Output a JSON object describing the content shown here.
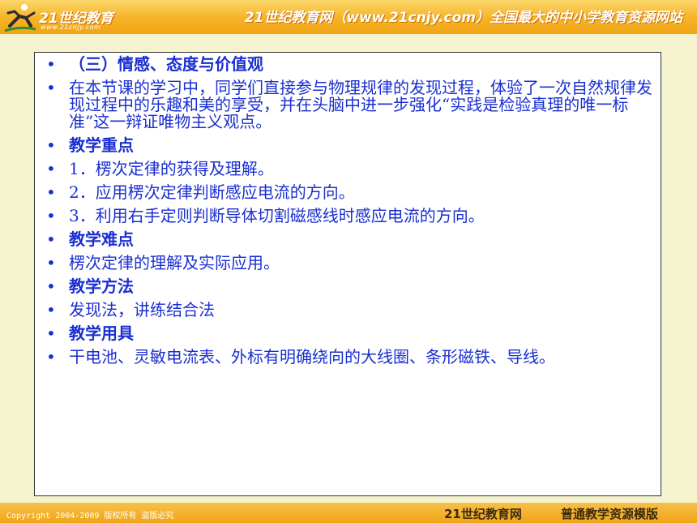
{
  "header": {
    "logo_text": "21世纪教育",
    "logo_url": "www.21cnjy.com",
    "tagline": "21世纪教育网（www.21cnjy.com）全国最大的中小学教育资源网站"
  },
  "content": {
    "items": [
      {
        "text": "（三）情感、态度与价值观",
        "bold": true
      },
      {
        "text": "在本节课的学习中，同学们直接参与物理规律的发现过程，体验了一次自然规律发现过程中的乐趣和美的享受，并在头脑中进一步强化“实践是检验真理的唯一标准”这一辩证唯物主义观点。",
        "bold": false
      },
      {
        "text": "教学重点",
        "bold": true
      },
      {
        "text": "1．楞次定律的获得及理解。",
        "bold": false
      },
      {
        "text": "2．应用楞次定律判断感应电流的方向。",
        "bold": false
      },
      {
        "text": "3．利用右手定则判断导体切割磁感线时感应电流的方向。",
        "bold": false
      },
      {
        "text": "教学难点",
        "bold": true
      },
      {
        "text": "楞次定律的理解及实际应用。",
        "bold": false
      },
      {
        "text": "教学方法",
        "bold": true
      },
      {
        "text": "发现法，讲练结合法",
        "bold": false
      },
      {
        "text": "教学用具",
        "bold": true
      },
      {
        "text": "干电池、灵敏电流表、外标有明确绕向的大线圈、条形磁铁、导线。",
        "bold": false
      }
    ],
    "bullet_glyph": "•"
  },
  "footer": {
    "copyright": "Copyright 2004-2009 版权所有 盗版必究",
    "site": "21世纪教育网",
    "template": "普通教学资源模版"
  },
  "colors": {
    "header_orange": "#f0a515",
    "text_blue": "#1a2fd1",
    "background": "#f5f2ce"
  }
}
